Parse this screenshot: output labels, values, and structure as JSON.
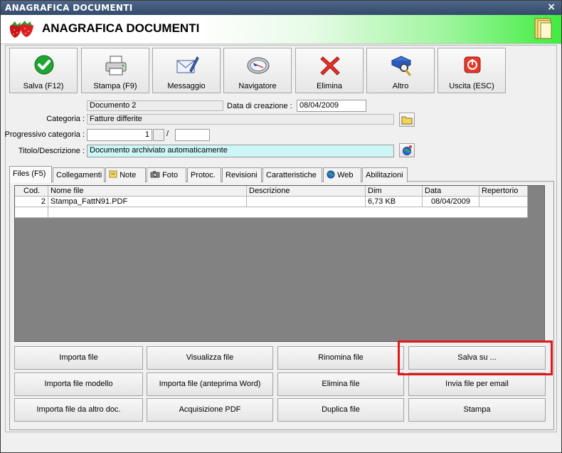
{
  "window": {
    "title": "ANAGRAFICA DOCUMENTI",
    "close_glyph": "×"
  },
  "header": {
    "title": "ANAGRAFICA DOCUMENTI",
    "logo_icon": "strawberries-icon",
    "folder_icon": "folder-icon"
  },
  "toolbar": {
    "buttons": [
      {
        "label": "Salva (F12)",
        "icon": "check-icon"
      },
      {
        "label": "Stampa (F9)",
        "icon": "printer-icon"
      },
      {
        "label": "Messaggio",
        "icon": "envelope-pen-icon"
      },
      {
        "label": "Navigatore",
        "icon": "compass-icon"
      },
      {
        "label": "Elimina",
        "icon": "delete-x-icon"
      },
      {
        "label": "Altro",
        "icon": "book-search-icon"
      },
      {
        "label": "Uscita (ESC)",
        "icon": "power-icon"
      }
    ]
  },
  "form": {
    "document_name": "Documento 2",
    "creation_date_label": "Data di creazione :",
    "creation_date": "08/04/2009",
    "category_label": "Categoria :",
    "category": "Fatture differite",
    "progressive_label": "Progressivo categoria :",
    "progressive": "1",
    "slash": "/",
    "progressive_suffix": "",
    "title_label": "Titolo/Descrizione :",
    "title_value": "Documento archiviato automaticamente"
  },
  "tabs": [
    {
      "label": "Files (F5)"
    },
    {
      "label": "Collegamenti"
    },
    {
      "label": "Note"
    },
    {
      "label": "Foto"
    },
    {
      "label": "Protoc."
    },
    {
      "label": "Revisioni"
    },
    {
      "label": "Caratteristiche"
    },
    {
      "label": "Web"
    },
    {
      "label": "Abilitazioni"
    }
  ],
  "files_table": {
    "columns": [
      "Cod.",
      "Nome file",
      "Descrizione",
      "Dim",
      "Data",
      "Repertorio"
    ],
    "rows": [
      [
        "2",
        "Stampa_FattN91.PDF",
        "",
        "6,73 KB",
        "08/04/2009",
        ""
      ]
    ]
  },
  "actions": {
    "import_file": "Importa file",
    "view_file": "Visualizza file",
    "rename_file": "Rinomina file",
    "save_to": "Salva su ...",
    "import_template": "Importa file modello",
    "import_word_preview": "Importa file (anteprima Word)",
    "delete_file": "Elimina file",
    "send_email": "Invia file per email",
    "import_other_doc": "Importa file da altro doc.",
    "pdf_acquisition": "Acquisizione PDF",
    "duplicate_file": "Duplica file",
    "print": "Stampa"
  },
  "colors": {
    "highlight": "#e01818",
    "title_field": "#ccf7f6",
    "header_gradient_end": "#40ec40"
  }
}
